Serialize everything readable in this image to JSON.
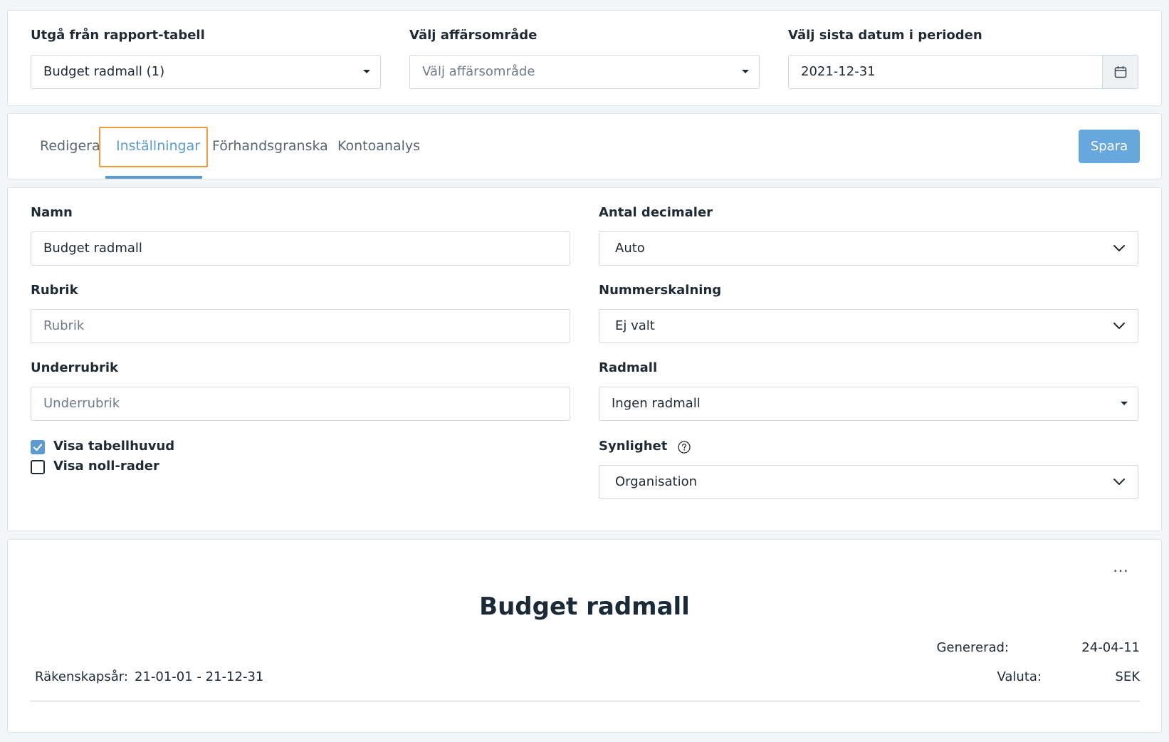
{
  "top": {
    "report_table_label": "Utgå från rapport-tabell",
    "report_table_value": "Budget radmall (1)",
    "business_area_label": "Välj affärsområde",
    "business_area_placeholder": "Välj affärsområde",
    "date_label": "Välj sista datum i perioden",
    "date_value": "2021-12-31"
  },
  "tabs": {
    "items": [
      {
        "label": "Redigera"
      },
      {
        "label": "Inställningar"
      },
      {
        "label": "Förhandsgranska"
      },
      {
        "label": "Kontoanalys"
      }
    ],
    "active": "Inställningar",
    "save_label": "Spara"
  },
  "settings": {
    "name_label": "Namn",
    "name_value": "Budget radmall",
    "rubrik_label": "Rubrik",
    "rubrik_placeholder": "Rubrik",
    "underrubrik_label": "Underrubrik",
    "underrubrik_placeholder": "Underrubrik",
    "show_header_label": "Visa tabellhuvud",
    "show_header_checked": true,
    "show_zero_rows_label": "Visa noll-rader",
    "show_zero_rows_checked": false,
    "decimals_label": "Antal decimaler",
    "decimals_value": "Auto",
    "scaling_label": "Nummerskalning",
    "scaling_value": "Ej valt",
    "row_template_label": "Radmall",
    "row_template_value": "Ingen radmall",
    "visibility_label": "Synlighet",
    "visibility_value": "Organisation"
  },
  "report": {
    "title": "Budget radmall",
    "generated_label": "Genererad:",
    "generated_value": "24-04-11",
    "fiscal_year_label": "Räkenskapsår:",
    "fiscal_year_value": "21-01-01 - 21-12-31",
    "currency_label": "Valuta:",
    "currency_value": "SEK",
    "more_icon": "…"
  },
  "colors": {
    "accent": "#5b9bd0",
    "save_button": "#66a8dd",
    "tab_highlight": "#ef9b3e"
  },
  "icons": {
    "calendar": "calendar-icon",
    "help": "question-circle-icon",
    "more": "ellipsis-icon",
    "check": "check-icon",
    "chevron": "chevron-down-icon",
    "caret": "caret-down-icon"
  }
}
